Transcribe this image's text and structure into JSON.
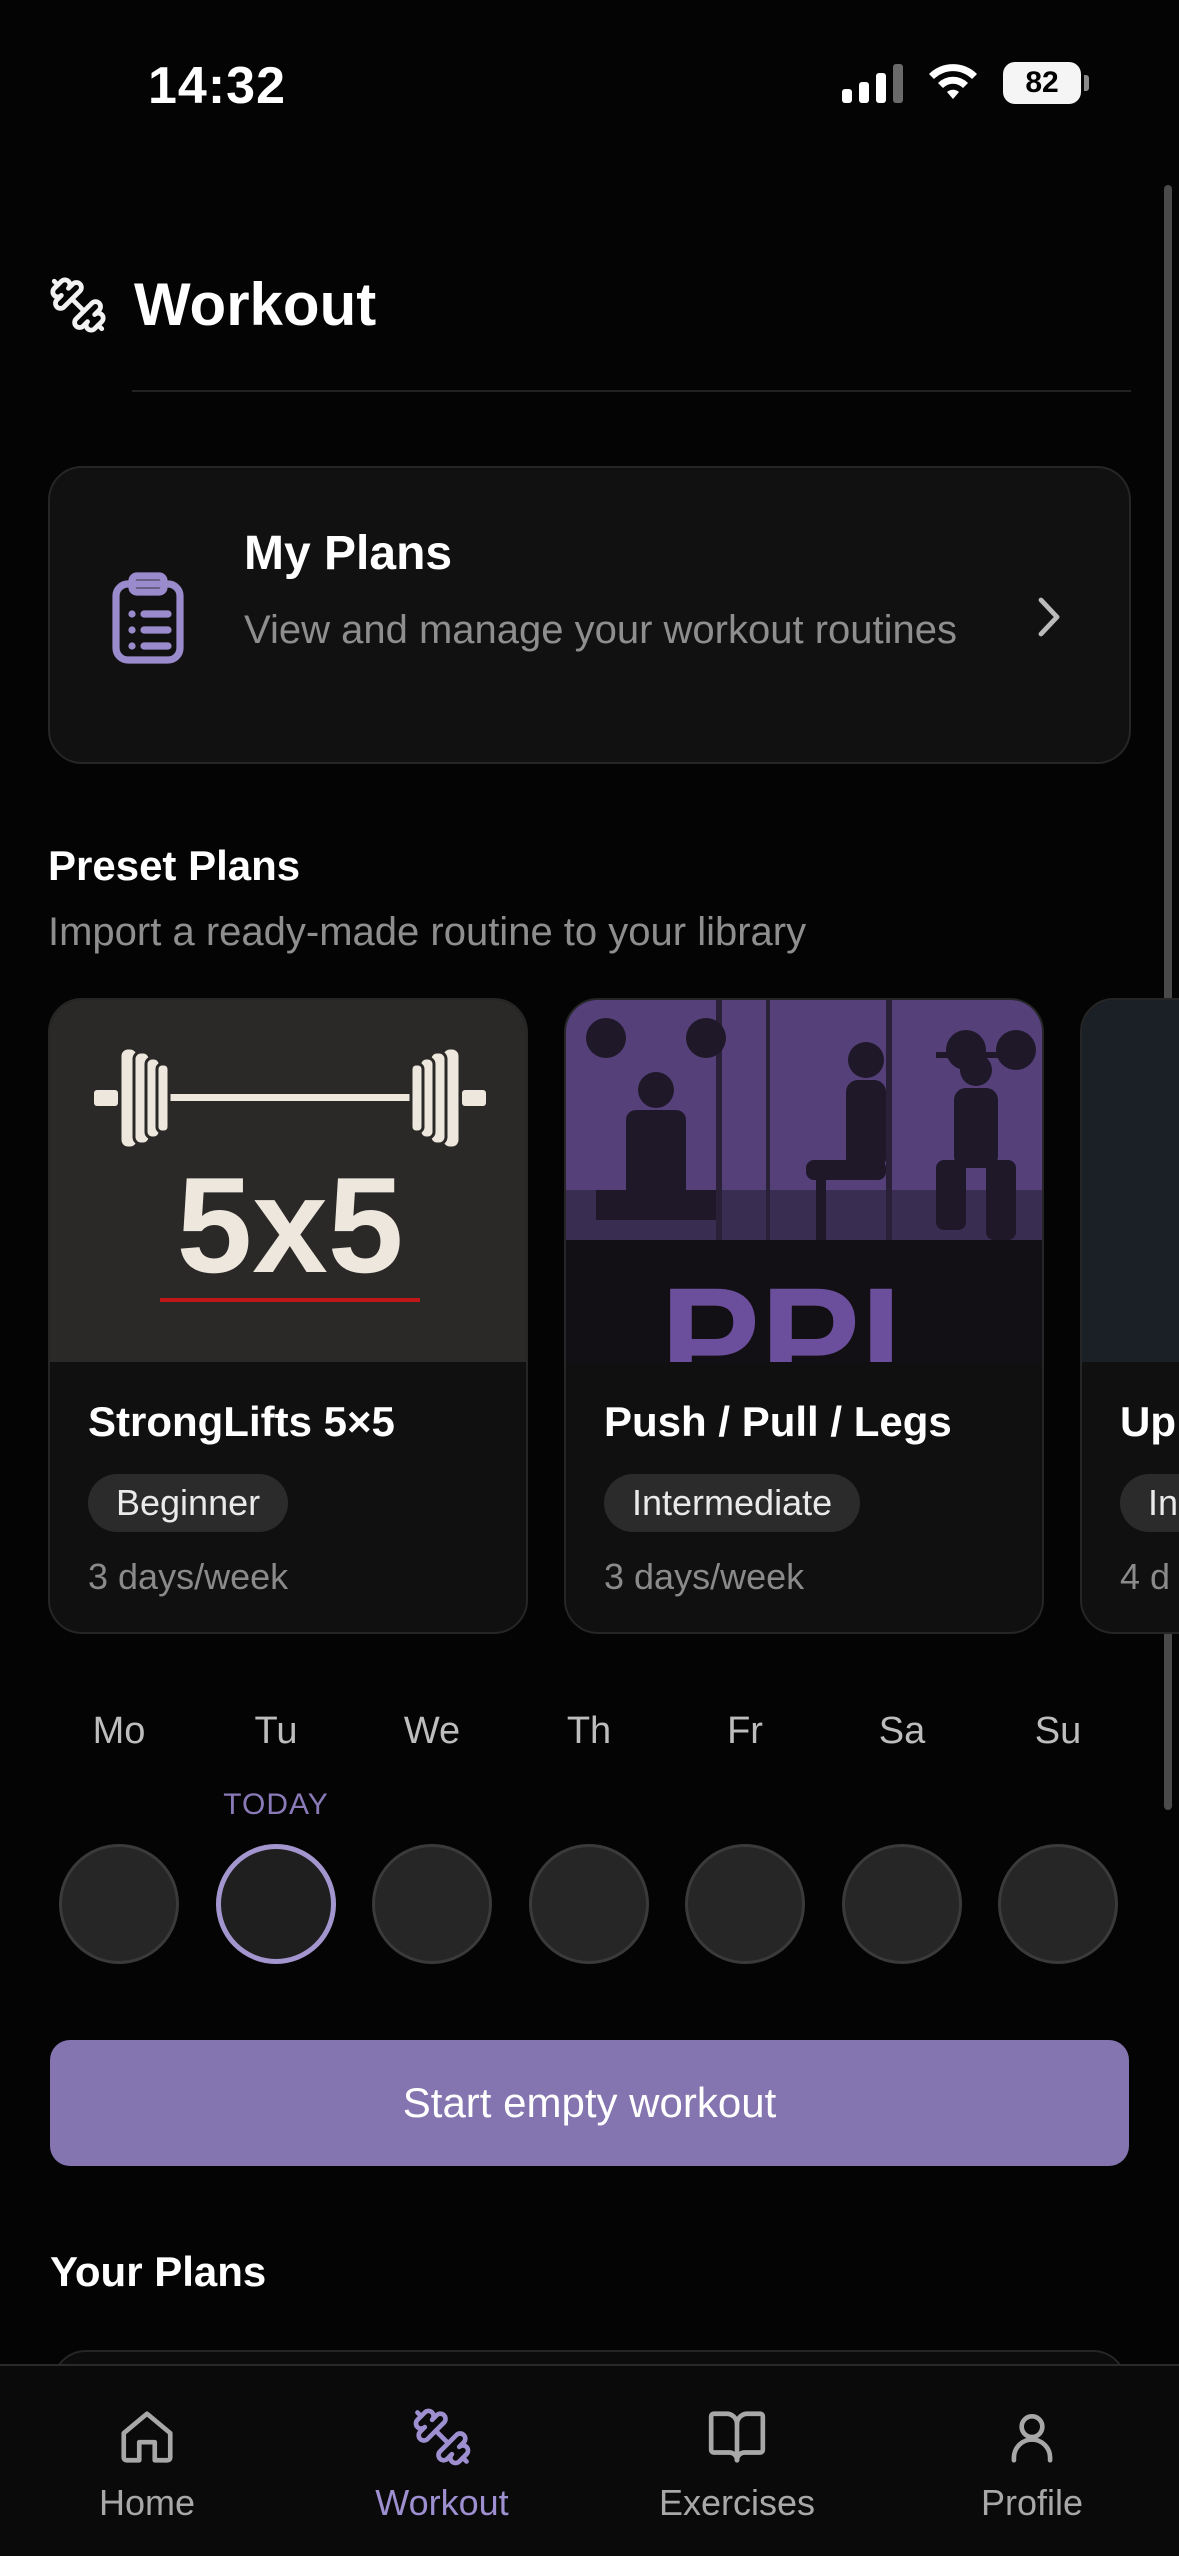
{
  "status_bar": {
    "time": "14:32",
    "battery": "82"
  },
  "header": {
    "title": "Workout",
    "icon": "dumbbell-icon"
  },
  "my_plans": {
    "title": "My Plans",
    "subtitle": "View and manage your workout routines",
    "icon": "clipboard-list-icon"
  },
  "preset_plans": {
    "title": "Preset Plans",
    "subtitle": "Import a ready-made routine to your library",
    "items": [
      {
        "image_text": "5x5",
        "name": "StrongLifts 5×5",
        "level": "Beginner",
        "frequency": "3 days/week"
      },
      {
        "image_text": "PPL",
        "name": "Push / Pull / Legs",
        "level": "Intermediate",
        "frequency": "3 days/week"
      },
      {
        "name": "Up",
        "level": "In",
        "frequency": "4 d"
      }
    ]
  },
  "week": {
    "days": [
      "Mo",
      "Tu",
      "We",
      "Th",
      "Fr",
      "Sa",
      "Su"
    ],
    "today_label": "TODAY"
  },
  "start_button": {
    "label": "Start empty workout"
  },
  "your_plans": {
    "title": "Your Plans"
  },
  "tab_bar": {
    "tabs": [
      {
        "label": "Home",
        "icon": "home-icon"
      },
      {
        "label": "Workout",
        "icon": "dumbbell-icon",
        "active": true
      },
      {
        "label": "Exercises",
        "icon": "book-open-icon"
      },
      {
        "label": "Profile",
        "icon": "user-icon"
      }
    ]
  },
  "colors": {
    "accent": "#8474b0",
    "background": "#040404",
    "card": "#111111"
  }
}
